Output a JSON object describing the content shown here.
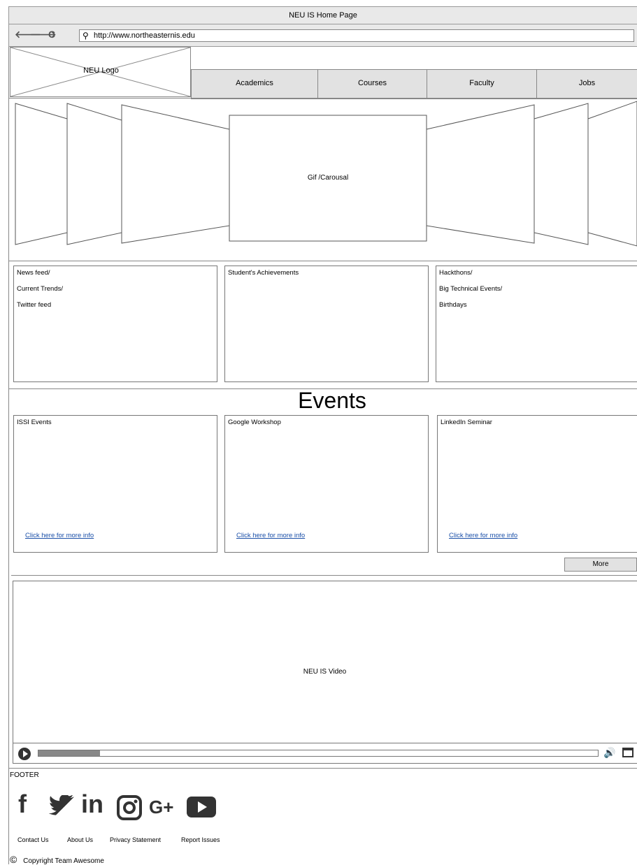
{
  "window": {
    "title": "NEU IS Home Page"
  },
  "browser": {
    "url": "http://www.northeasternis.edu",
    "back_icon": "back-arrow-icon",
    "forward_icon": "forward-arrow-icon",
    "reload_icon": "reload-icon",
    "menu_icon": "menu-icon"
  },
  "header": {
    "logo_label": "NEU Logo",
    "tabs": [
      "Academics",
      "Courses",
      "Faculty",
      "Jobs"
    ]
  },
  "carousel": {
    "label": "Gif /Carousal"
  },
  "info_panels": [
    {
      "lines": [
        "News feed/",
        "Current Trends/",
        "Twitter feed"
      ]
    },
    {
      "lines": [
        "Student's Achievements"
      ]
    },
    {
      "lines": [
        "Hackthons/",
        "Big Technical Events/",
        "Birthdays"
      ]
    }
  ],
  "events": {
    "title": "Events",
    "cards": [
      {
        "title": "ISSI Events",
        "link": "Click here for more info"
      },
      {
        "title": "Google Workshop",
        "link": "Click here for more info"
      },
      {
        "title": "LinkedIn Seminar",
        "link": "Click here for more info"
      }
    ],
    "more_label": "More"
  },
  "video": {
    "label": "NEU IS Video",
    "progress": 0.11
  },
  "footer": {
    "label": "FOOTER",
    "social": [
      {
        "name": "facebook-icon",
        "glyph": "f"
      },
      {
        "name": "twitter-icon",
        "glyph": "🐦"
      },
      {
        "name": "linkedin-icon",
        "glyph": "in"
      },
      {
        "name": "instagram-icon",
        "glyph": "◙"
      },
      {
        "name": "google-plus-icon",
        "glyph": "G+"
      },
      {
        "name": "youtube-icon",
        "glyph": "▶"
      }
    ],
    "links": [
      "Contact Us",
      "About Us",
      "Privacy Statement",
      "Report Issues"
    ],
    "copyright": "Copyright Team Awesome"
  }
}
